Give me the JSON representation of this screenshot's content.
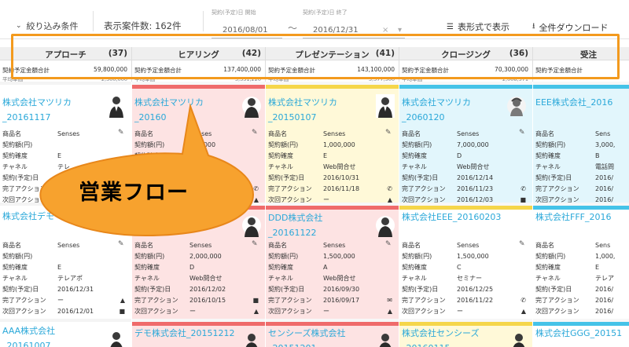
{
  "toolbar": {
    "filter_label": "絞り込み条件",
    "count_label": "表示案件数: 162件",
    "date_start_label": "契約(予定)日 開始",
    "date_start_value": "2016/08/01",
    "date_end_label": "契約(予定)日 終了",
    "date_end_value": "2016/12/31",
    "tilde": "〜",
    "clear_symbol": "×",
    "table_view_label": "表形式で表示",
    "download_label": "全件ダウンロード"
  },
  "stages": [
    {
      "name": "アプローチ",
      "count": "(37)",
      "sum_label": "契約予定金額合計",
      "sum_value": "59,800,000",
      "avg_label": "平均単価",
      "avg_value": "2,300,000"
    },
    {
      "name": "ヒアリング",
      "count": "(42)",
      "sum_label": "契約予定金額合計",
      "sum_value": "137,400,000",
      "avg_label": "平均単価",
      "avg_value": "3,351,220"
    },
    {
      "name": "プレゼンテーション",
      "count": "(41)",
      "sum_label": "契約予定金額合計",
      "sum_value": "143,100,000",
      "avg_label": "平均単価",
      "avg_value": "3,577,500"
    },
    {
      "name": "クロージング",
      "count": "(36)",
      "sum_label": "契約予定金額合計",
      "sum_value": "70,300,000",
      "avg_label": "平均単価",
      "avg_value": "2,008,571"
    },
    {
      "name": "受注",
      "count": "",
      "sum_label": "契約予定金額合計",
      "sum_value": "",
      "avg_label": "",
      "avg_value": ""
    }
  ],
  "field_labels": {
    "product": "商品名",
    "amount": "契約額(円)",
    "certainty": "契約確度",
    "channel": "チャネル",
    "date": "契約(予定)日",
    "done_action": "完了アクション",
    "next_action": "次回アクション"
  },
  "cards": {
    "c1a": {
      "title": "株式会社マツリカ_20161117",
      "product": "Senses",
      "amount": "",
      "certainty": "E",
      "channel": "テレ",
      "date": "",
      "done": "",
      "next": ""
    },
    "c1b": {
      "title": "株式会社デモ",
      "product": "Senses",
      "amount": "",
      "certainty": "E",
      "channel": "テレアポ",
      "date": "2016/12/31",
      "done": "ー",
      "next": "2016/12/01"
    },
    "c1c": {
      "title": "AAA株式会社_20161007"
    },
    "c2a": {
      "title": "株式会社マツリカ_20160",
      "product": "Senses",
      "amount": "600,000",
      "certainty": "B",
      "channel": "",
      "date": "",
      "done": "",
      "next": ""
    },
    "c2b": {
      "title": "",
      "product": "Senses",
      "amount": "2,000,000",
      "certainty": "D",
      "channel": "Web問合せ",
      "date": "2016/12/02",
      "done": "2016/10/15",
      "next": "ー"
    },
    "c2c": {
      "title": "デモ株式会社_20151212"
    },
    "c3a": {
      "title": "株式会社マツリカ_20150107",
      "product": "Senses",
      "amount": "1,000,000",
      "certainty": "E",
      "channel": "Web問合せ",
      "date": "2016/10/31",
      "done": "2016/11/18",
      "next": "ー"
    },
    "c3b": {
      "title": "DDD株式会社_20161122",
      "product": "Senses",
      "amount": "1,500,000",
      "certainty": "A",
      "channel": "Web問合せ",
      "date": "2016/09/30",
      "done": "2016/09/17",
      "next": "ー"
    },
    "c3c": {
      "title": "センシーズ株式会社_20151201"
    },
    "c4a": {
      "title": "株式会社マツリカ_2060120",
      "product": "Senses",
      "amount": "7,000,000",
      "certainty": "D",
      "channel": "Web問合せ",
      "date": "2016/12/14",
      "done": "2016/11/23",
      "next": "2016/12/03"
    },
    "c4b": {
      "title": "株式会社EEE_20160203",
      "product": "Senses",
      "amount": "1,500,000",
      "certainty": "C",
      "channel": "セミナー",
      "date": "2016/12/25",
      "done": "2016/11/22",
      "next": "ー"
    },
    "c4c": {
      "title": "株式会社センシーズ_20160115"
    },
    "c5a": {
      "title": "EEE株式会社_2016",
      "product": "Sens",
      "amount": "3,000,",
      "certainty": "B",
      "channel": "電話問",
      "date": "2016/",
      "done": "2016/",
      "next": "2016/"
    },
    "c5b": {
      "title": "株式会社FFF_2016",
      "product": "Sens",
      "amount": "1,000,",
      "certainty": "E",
      "channel": "テレア",
      "date": "2016/",
      "done": "2016/",
      "next": "2016/"
    },
    "c5c": {
      "title": "株式会社GGG_20151"
    }
  },
  "callout": {
    "text": "営業フロー"
  },
  "colors": {
    "orange": "#f39a1e",
    "link_blue": "#2aa8d9",
    "bar_red": "#ef6b6b",
    "bar_yellow": "#f5d64a",
    "bar_cyan": "#45c3e8"
  }
}
